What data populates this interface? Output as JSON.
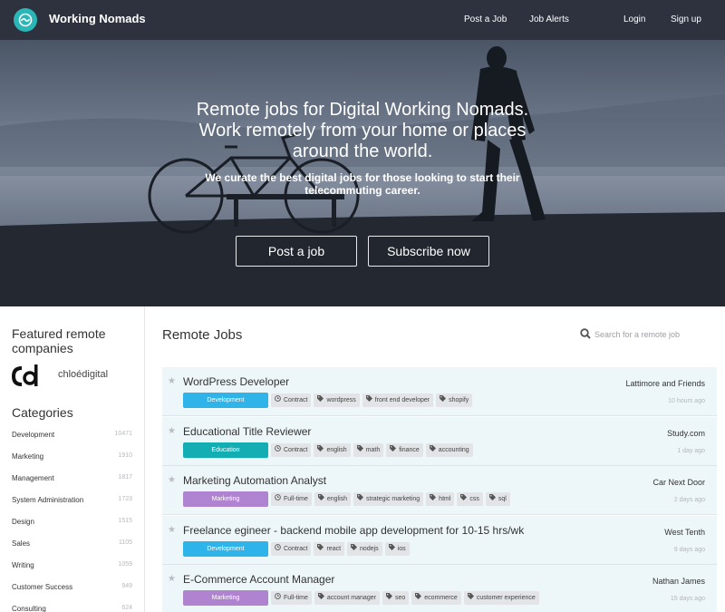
{
  "header": {
    "brand": "Working Nomads",
    "nav": {
      "post_job": "Post a Job",
      "job_alerts": "Job Alerts",
      "login": "Login",
      "signup": "Sign up"
    }
  },
  "hero": {
    "title_line1": "Remote jobs for Digital Working Nomads.",
    "title_line2": "Work remotely from your home or places",
    "title_line3": "around the world.",
    "subtitle_line1": "We curate the best digital jobs for those looking to start their",
    "subtitle_line2": "telecommuting career.",
    "post_button": "Post a job",
    "subscribe_button": "Subscribe now"
  },
  "sidebar": {
    "featured_title_line1": "Featured remote",
    "featured_title_line2": "companies",
    "featured_company": "chloédigital",
    "categories_title": "Categories",
    "categories": [
      {
        "name": "Development",
        "count": "10471"
      },
      {
        "name": "Marketing",
        "count": "1910"
      },
      {
        "name": "Management",
        "count": "1817"
      },
      {
        "name": "System Administration",
        "count": "1723"
      },
      {
        "name": "Design",
        "count": "1515"
      },
      {
        "name": "Sales",
        "count": "1105"
      },
      {
        "name": "Writing",
        "count": "1059"
      },
      {
        "name": "Customer Success",
        "count": "949"
      },
      {
        "name": "Consulting",
        "count": "624"
      }
    ]
  },
  "main": {
    "title": "Remote Jobs",
    "search_placeholder": "Search for a remote job",
    "jobs": [
      {
        "title": "WordPress Developer",
        "category": "Development",
        "company": "Lattimore and Friends",
        "age": "10 hours ago",
        "type": "Contract",
        "tags": [
          "wordpress",
          "front end developer",
          "shopify"
        ]
      },
      {
        "title": "Educational Title Reviewer",
        "category": "Education",
        "company": "Study.com",
        "age": "1 day ago",
        "type": "Contract",
        "tags": [
          "english",
          "math",
          "finance",
          "accounting"
        ]
      },
      {
        "title": "Marketing Automation Analyst",
        "category": "Marketing",
        "company": "Car Next Door",
        "age": "2 days ago",
        "type": "Full-time",
        "tags": [
          "english",
          "strategic marketing",
          "html",
          "css",
          "sql"
        ]
      },
      {
        "title": "Freelance egineer - backend mobile app development for 10-15 hrs/wk",
        "category": "Development",
        "company": "West Tenth",
        "age": "9 days ago",
        "type": "Contract",
        "tags": [
          "react",
          "nodejs",
          "ios"
        ]
      },
      {
        "title": "E-Commerce Account Manager",
        "category": "Marketing",
        "company": "Nathan James",
        "age": "15 days ago",
        "type": "Full-time",
        "tags": [
          "account manager",
          "seo",
          "ecommerce",
          "customer experience"
        ]
      }
    ]
  },
  "colors": {
    "topbar": "#2d323e",
    "brand_teal": "#2ab5b6",
    "badge_development": "#2fb4e9",
    "badge_education": "#13aeb3",
    "badge_marketing": "#b083d0",
    "job_row_bg": "#edf6f8"
  },
  "icons": {
    "logo": "globe-wave-icon",
    "search": "search-icon",
    "star": "star-icon",
    "tag": "tag-icon",
    "job_type": "clock-icon"
  }
}
